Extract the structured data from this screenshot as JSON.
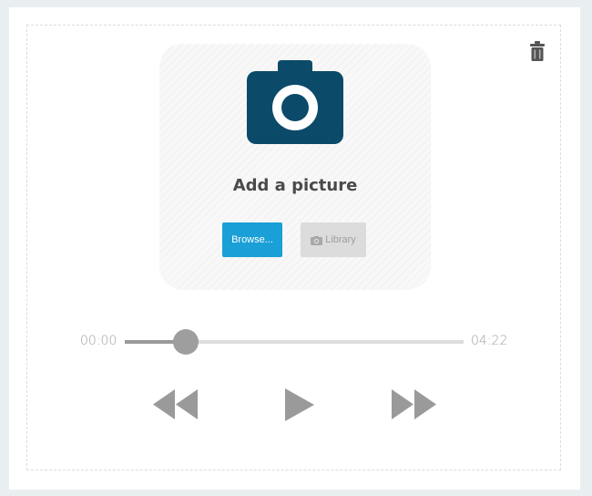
{
  "dropzone": {
    "title": "Add a picture",
    "browse_label": "Browse...",
    "library_label": "Library",
    "camera_icon": "camera-icon",
    "color": "#0c4a6a"
  },
  "player": {
    "current_time": "00:00",
    "total_time": "04:22",
    "progress": 0.18,
    "controls": [
      "rewind-icon",
      "play-icon",
      "fast-forward-icon"
    ],
    "accent": "#9a9a9a"
  },
  "actions": {
    "delete_icon": "trash-icon"
  },
  "colors": {
    "browse_button": "#1a9fd6",
    "library_button": "#dcdcdc"
  }
}
